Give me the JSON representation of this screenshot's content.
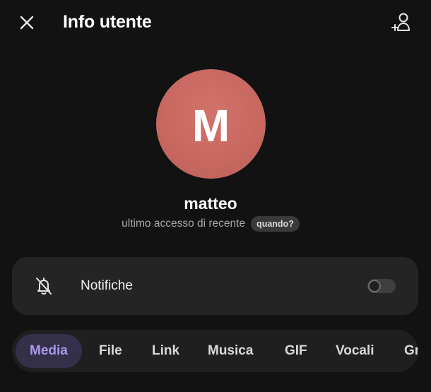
{
  "header": {
    "title": "Info utente",
    "close_icon": "close-icon",
    "add_contact_icon": "add-contact-icon"
  },
  "profile": {
    "avatar_letter": "M",
    "avatar_color": "#c86961",
    "name": "matteo",
    "status": "ultimo accesso di recente",
    "when_label": "quando?"
  },
  "notifications": {
    "label": "Notifiche",
    "icon": "bell-off-icon",
    "enabled": false
  },
  "tabs": [
    {
      "label": "Media",
      "active": true
    },
    {
      "label": "File",
      "active": false
    },
    {
      "label": "Link",
      "active": false
    },
    {
      "label": "Musica",
      "active": false
    },
    {
      "label": "GIF",
      "active": false
    },
    {
      "label": "Vocali",
      "active": false
    },
    {
      "label": "Gr",
      "active": false
    }
  ],
  "colors": {
    "background": "#121212",
    "card": "#242424",
    "accent": "#a998e9",
    "accent_bg": "#35304a"
  }
}
